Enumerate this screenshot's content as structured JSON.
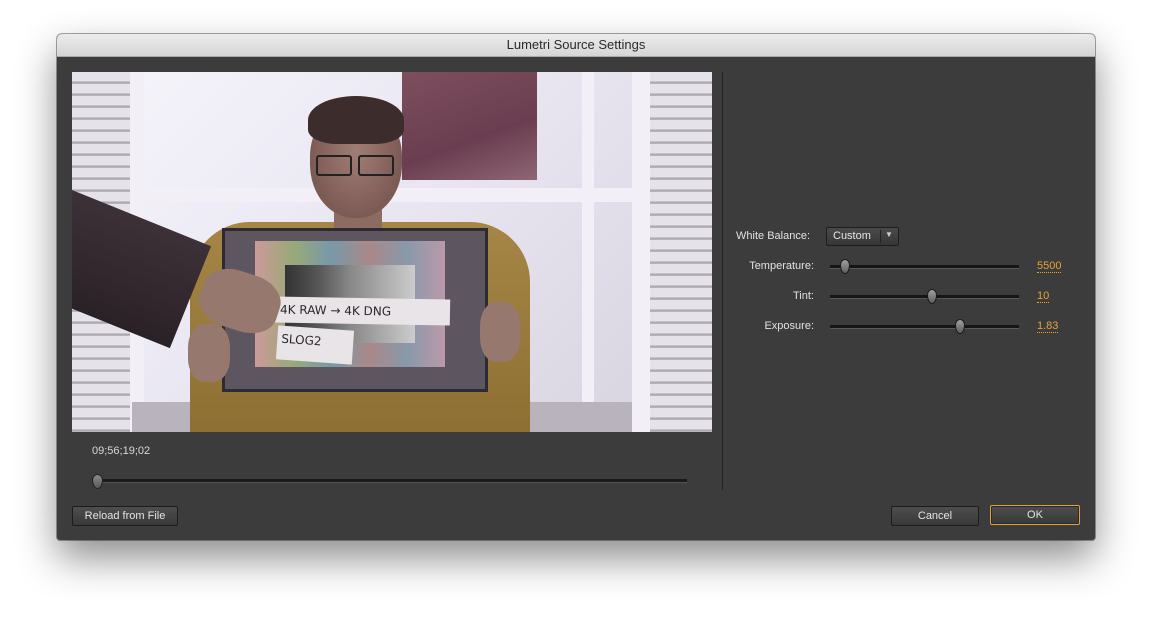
{
  "window": {
    "title": "Lumetri Source Settings"
  },
  "preview": {
    "paper_text_1": "4K RAW → 4K DNG",
    "paper_text_2": "SLOG2",
    "timecode": "09;56;19;02",
    "scrub_position": 0.0
  },
  "settings": {
    "white_balance": {
      "label": "White Balance:",
      "value": "Custom"
    },
    "temperature": {
      "label": "Temperature:",
      "value": "5500",
      "slider_fraction": 0.07
    },
    "tint": {
      "label": "Tint:",
      "value": "10",
      "slider_fraction": 0.53
    },
    "exposure": {
      "label": "Exposure:",
      "value": "1.83",
      "slider_fraction": 0.69
    }
  },
  "buttons": {
    "reload": "Reload from File",
    "cancel": "Cancel",
    "ok": "OK"
  },
  "colors": {
    "value_accent": "#e8a332",
    "dialog_bg": "#3c3c3c"
  }
}
